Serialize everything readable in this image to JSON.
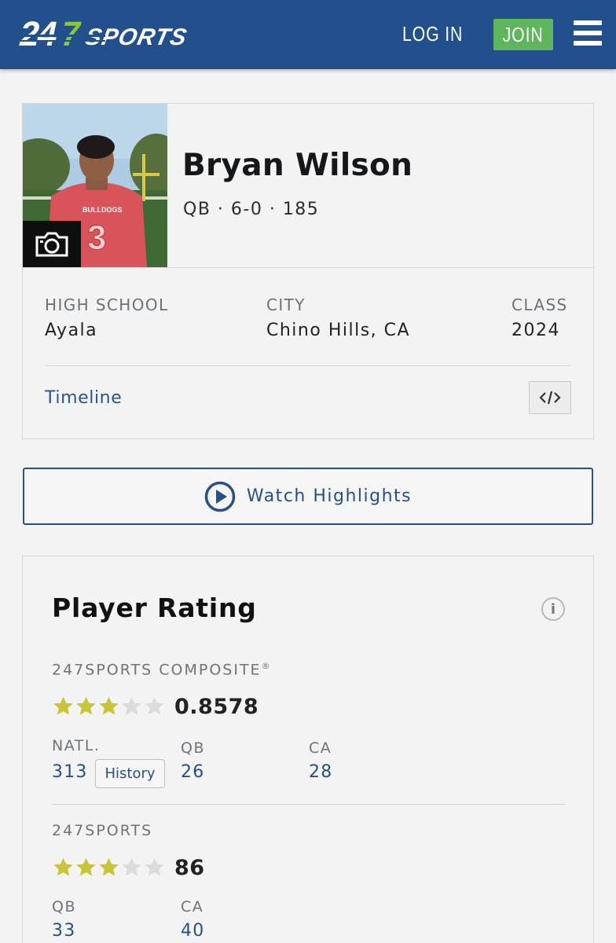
{
  "header": {
    "logo_text": "247SPORTS",
    "login_label": "LOG IN",
    "join_label": "JOIN",
    "brand_color": "#21508d",
    "join_color": "#5fb55c"
  },
  "player": {
    "name": "Bryan Wilson",
    "meta": "QB · 6-0 · 185",
    "fields": [
      {
        "label": "HIGH SCHOOL",
        "value": "Ayala"
      },
      {
        "label": "CITY",
        "value": "Chino Hills, CA"
      },
      {
        "label": "CLASS",
        "value": "2024"
      }
    ],
    "timeline_label": "Timeline"
  },
  "highlights": {
    "label": "Watch Highlights"
  },
  "rating": {
    "title": "Player Rating",
    "composite": {
      "label": "247SPORTS COMPOSITE",
      "mark": "®",
      "stars": 3,
      "max_stars": 5,
      "score": "0.8578",
      "ranks": [
        {
          "label": "NATL.",
          "value": "313"
        },
        {
          "label": "QB",
          "value": "26"
        },
        {
          "label": "CA",
          "value": "28"
        }
      ],
      "history_label": "History"
    },
    "sports247": {
      "label": "247SPORTS",
      "stars": 3,
      "max_stars": 5,
      "score": "86",
      "ranks": [
        {
          "label": "QB",
          "value": "33"
        },
        {
          "label": "CA",
          "value": "40"
        }
      ]
    },
    "star_on_color": "#c9c43a",
    "star_off_color": "#dcdcdc"
  }
}
